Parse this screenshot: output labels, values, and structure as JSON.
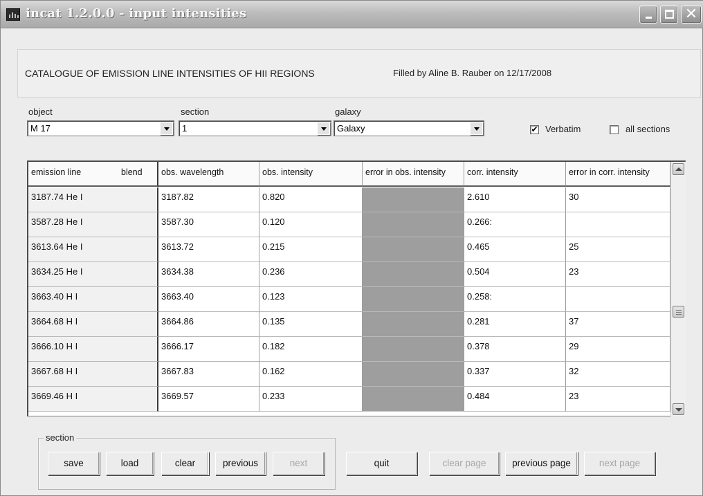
{
  "window": {
    "title": "incat 1.2.0.0 - input intensities",
    "controls": [
      "minimize-icon",
      "maximize-icon",
      "close-icon"
    ]
  },
  "header": {
    "catalogue": "CATALOGUE OF EMISSION LINE INTENSITIES OF HII REGIONS",
    "filled_by": "Filled by Aline B. Rauber on 12/17/2008"
  },
  "selectors": {
    "object": {
      "label": "object",
      "value": "M 17"
    },
    "section": {
      "label": "section",
      "value": "1"
    },
    "galaxy": {
      "label": "galaxy",
      "value": "Galaxy"
    }
  },
  "options": {
    "verbatim": {
      "label": "Verbatim",
      "checked": true
    },
    "all_sections": {
      "label": "all sections",
      "checked": false
    }
  },
  "table": {
    "headers": {
      "emission_line": "emission line",
      "blend": "blend",
      "obs_wavelength": "obs. wavelength",
      "obs_intensity": "obs. intensity",
      "err_obs": "error in obs. intensity",
      "corr_intensity": "corr. intensity",
      "err_corr": "error in corr. intensity"
    },
    "rows": [
      [
        "3187.74 He I",
        "3187.82",
        "0.820",
        "",
        "2.610",
        "30"
      ],
      [
        "3587.28 He I",
        "3587.30",
        "0.120",
        "",
        "0.266:",
        ""
      ],
      [
        "3613.64 He I",
        "3613.72",
        "0.215",
        "",
        "0.465",
        "25"
      ],
      [
        "3634.25 He I",
        "3634.38",
        "0.236",
        "",
        "0.504",
        "23"
      ],
      [
        "3663.40 H I",
        "3663.40",
        "0.123",
        "",
        "0.258:",
        ""
      ],
      [
        "3664.68 H I",
        "3664.86",
        "0.135",
        "",
        "0.281",
        "37"
      ],
      [
        "3666.10 H I",
        "3666.17",
        "0.182",
        "",
        "0.378",
        "29"
      ],
      [
        "3667.68 H I",
        "3667.83",
        "0.162",
        "",
        "0.337",
        "32"
      ],
      [
        "3669.46 H I",
        "3669.57",
        "0.233",
        "",
        "0.484",
        "23"
      ]
    ]
  },
  "section_group": {
    "label": "section",
    "buttons": {
      "save": "save",
      "load": "load",
      "clear": "clear",
      "previous": "previous",
      "next": "next"
    }
  },
  "page_buttons": {
    "quit": "quit",
    "clear_page": "clear page",
    "previous_page": "previous page",
    "next_page": "next page"
  },
  "colors": {
    "window_bg": "#ececec",
    "titlebar_text": "#f7f7f7",
    "disabled_cell": "#9e9e9e",
    "disabled_text": "#a6a6a6"
  }
}
